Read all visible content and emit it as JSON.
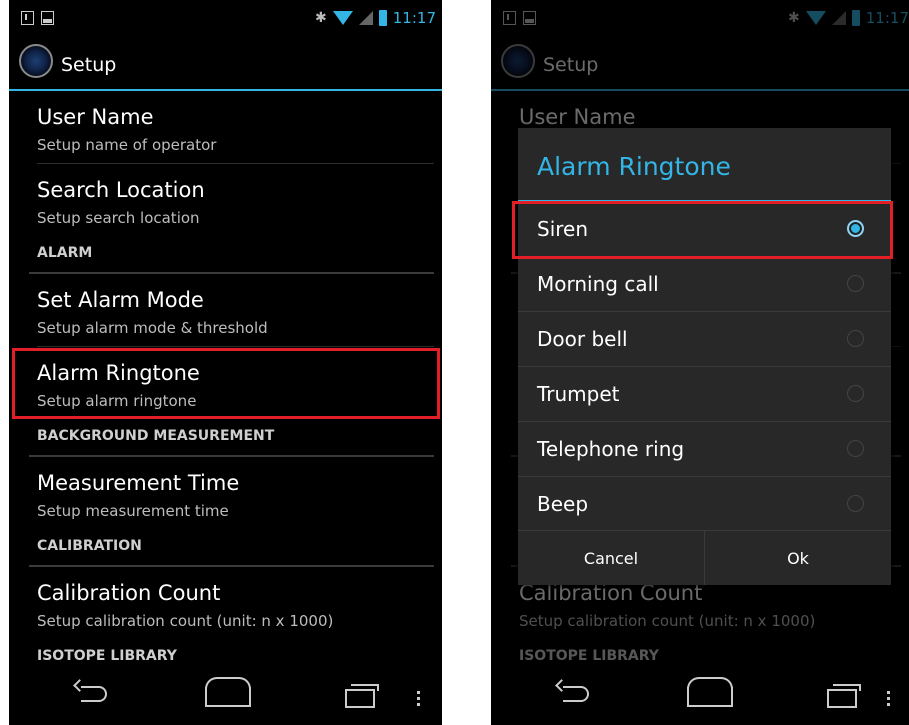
{
  "status_bar": {
    "time": "11:17",
    "bluetooth_icon": "bluetooth-icon",
    "wifi_icon": "wifi-icon",
    "battery_icon": "battery-icon"
  },
  "action_bar": {
    "title": "Setup",
    "icon": "app-logo-icon"
  },
  "preferences": {
    "user_name": {
      "title": "User Name",
      "summary": "Setup name of operator"
    },
    "search_location": {
      "title": "Search Location",
      "summary": "Setup search location"
    },
    "alarm_category": "ALARM",
    "alarm_mode": {
      "title": "Set Alarm Mode",
      "summary": "Setup alarm mode & threshold"
    },
    "alarm_ringtone": {
      "title": "Alarm Ringtone",
      "summary": "Setup alarm ringtone"
    },
    "background_category": "BACKGROUND MEASUREMENT",
    "measurement_time": {
      "title": "Measurement Time",
      "summary": "Setup measurement time"
    },
    "calibration_category": "CALIBRATION",
    "calibration_count": {
      "title": "Calibration Count",
      "summary": "Setup calibration count (unit: n x 1000)"
    },
    "isotope_category": "ISOTOPE LIBRARY"
  },
  "dialog": {
    "title": "Alarm Ringtone",
    "options": [
      "Siren",
      "Morning call",
      "Door bell",
      "Trumpet",
      "Telephone ring",
      "Beep"
    ],
    "selected": "Siren",
    "cancel_label": "Cancel",
    "ok_label": "Ok"
  },
  "colors": {
    "accent": "#33b5e5",
    "highlight": "#e21f26",
    "background": "#000000"
  }
}
